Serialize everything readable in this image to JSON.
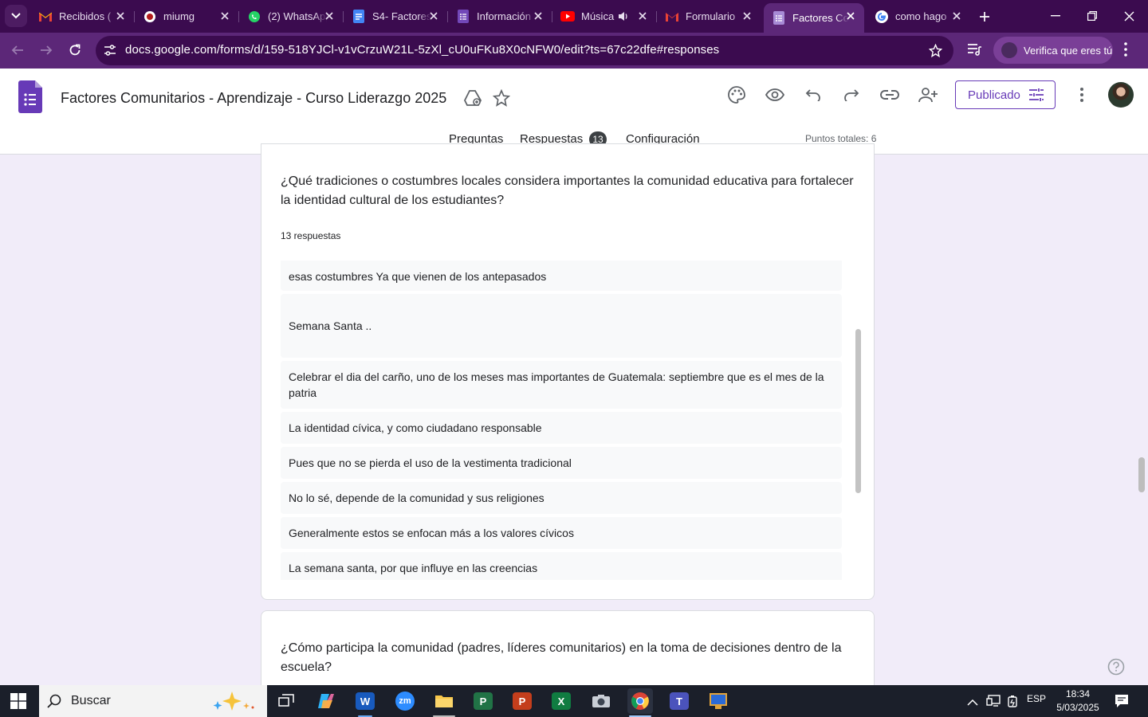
{
  "browser": {
    "tabs": [
      {
        "title": "Recibidos (",
        "icon": "gmail-icon"
      },
      {
        "title": "miumg",
        "icon": "umg-icon"
      },
      {
        "title": "(2) WhatsApp",
        "icon": "whatsapp-icon"
      },
      {
        "title": "S4- Factores",
        "icon": "docs-icon"
      },
      {
        "title": "Información",
        "icon": "forms-icon"
      },
      {
        "title": "Música",
        "icon": "youtube-icon"
      },
      {
        "title": "Formulario",
        "icon": "gmail-icon"
      },
      {
        "title": "Factores Co",
        "icon": "forms-icon",
        "active": true
      },
      {
        "title": "como hago",
        "icon": "google-icon"
      }
    ],
    "url": "docs.google.com/forms/d/159-518YJCl-v1vCrzuW21L-5zXl_cU0uFKu8X0cNFW0/edit?ts=67c22dfe#responses",
    "verify_label": "Verifica que eres tú"
  },
  "form": {
    "title": "Factores  Comunitarios - Aprendizaje - Curso Liderazgo 2025",
    "publish_label": "Publicado",
    "nav_tabs": {
      "questions": "Preguntas",
      "responses": "Respuestas",
      "settings": "Configuración"
    },
    "responses_count": "13",
    "total_points": "Puntos totales: 6"
  },
  "question1": {
    "text": "¿Qué tradiciones o costumbres locales considera importantes la comunidad educativa para fortalecer la identidad cultural de los estudiantes?",
    "count": "13 respuestas",
    "responses": [
      "esas costumbres Ya que vienen de los antepasados",
      "Semana Santa ..",
      "Celebrar el dia del carño, uno de los meses mas importantes de Guatemala: septiembre que es el mes de la patria",
      "La identidad cívica, y como ciudadano responsable",
      "Pues que no se pierda el uso de la vestimenta tradicional",
      "No lo sé, depende de la comunidad y sus religiones",
      "Generalmente estos se enfocan más a los valores cívicos",
      "La semana santa, por que influye en las creencias"
    ]
  },
  "question2": {
    "text": "¿Cómo participa la comunidad (padres, líderes comunitarios) en la toma de decisiones dentro de la escuela?"
  },
  "taskbar": {
    "search_label": "Buscar",
    "language": "ESP",
    "time": "18:34",
    "date": "5/03/2025"
  }
}
